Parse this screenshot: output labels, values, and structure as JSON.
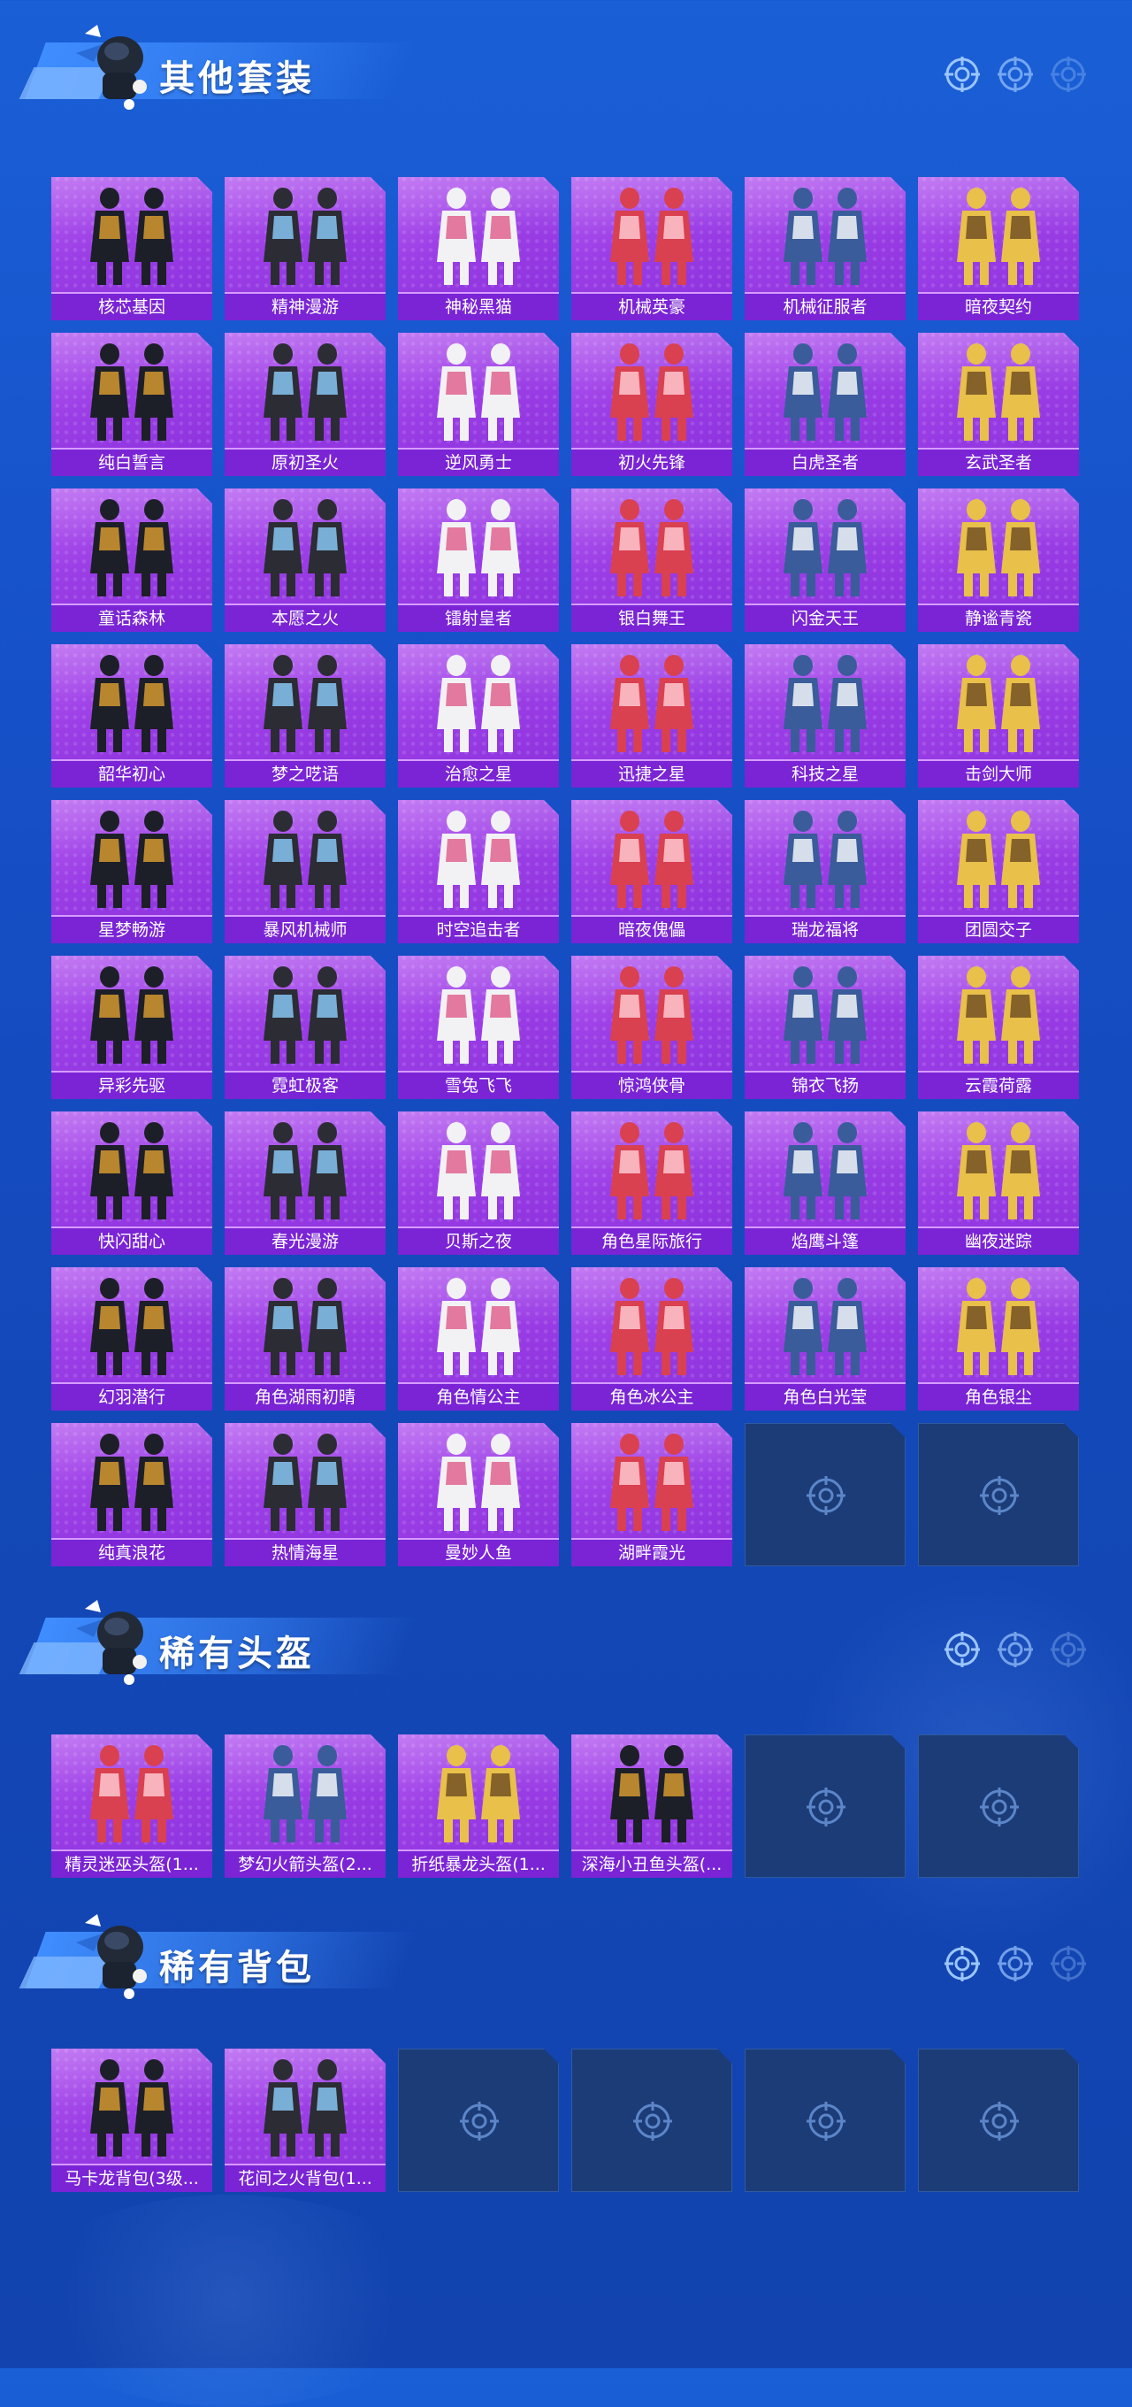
{
  "sections": [
    {
      "title": "其他套装",
      "items": [
        "核芯基因",
        "精神漫游",
        "神秘黑猫",
        "机械英豪",
        "机械征服者",
        "暗夜契约",
        "纯白誓言",
        "原初圣火",
        "逆风勇士",
        "初火先锋",
        "白虎圣者",
        "玄武圣者",
        "童话森林",
        "本愿之火",
        "镭射皇者",
        "银白舞王",
        "闪金天王",
        "静谧青瓷",
        "韶华初心",
        "梦之呓语",
        "治愈之星",
        "迅捷之星",
        "科技之星",
        "击剑大师",
        "星梦畅游",
        "暴风机械师",
        "时空追击者",
        "暗夜傀儡",
        "瑞龙福将",
        "团圆交子",
        "异彩先驱",
        "霓虹极客",
        "雪兔飞飞",
        "惊鸿侠骨",
        "锦衣飞扬",
        "云霞荷露",
        "快闪甜心",
        "春光漫游",
        "贝斯之夜",
        "角色星际旅行",
        "焰鹰斗篷",
        "幽夜迷踪",
        "幻羽潜行",
        "角色湖雨初晴",
        "角色情公主",
        "角色冰公主",
        "角色白光莹",
        "角色银尘",
        "纯真浪花",
        "热情海星",
        "曼妙人鱼",
        "湖畔霞光"
      ],
      "empty_slots": 2
    },
    {
      "title": "稀有头盔",
      "items": [
        "精灵迷巫头盔(1...",
        "梦幻火箭头盔(2...",
        "折纸暴龙头盔(1...",
        "深海小丑鱼头盔(..."
      ],
      "empty_slots": 2
    },
    {
      "title": "稀有背包",
      "items": [
        "马卡龙背包(3级...",
        "花间之火背包(1..."
      ],
      "empty_slots": 4
    }
  ],
  "colors": {
    "card_purple": "#9b3ee6",
    "label_purple": "#7a24d6",
    "empty_slot": "#1c3c78",
    "background": "#1650c8"
  },
  "icons": {
    "header_dot": "crosshair-target-icon",
    "empty_slot": "crosshair-target-icon",
    "mascot": "mascot-character-icon"
  }
}
